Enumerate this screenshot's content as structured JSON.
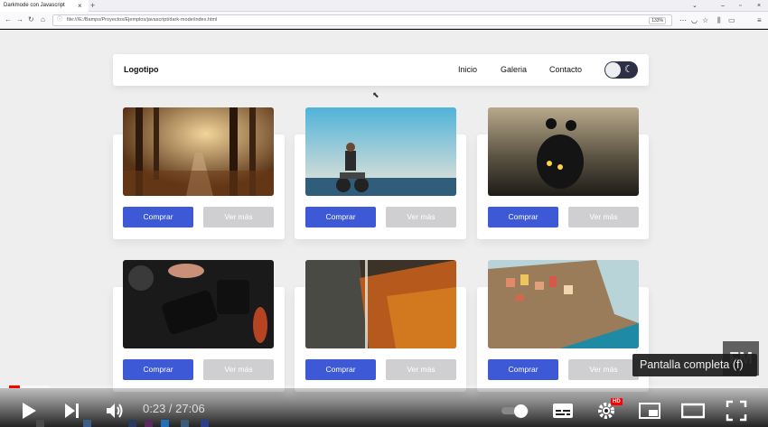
{
  "browser": {
    "tab_title": "Darkmode con Javascript",
    "tab_close": "×",
    "new_tab": "+",
    "url": "file:///E:/Bamps/Proyectos/Ejemplos/javascript/dark-mode/index.html",
    "zoom": "133%"
  },
  "site": {
    "logo": "Logotipo",
    "nav": [
      "Inicio",
      "Galeria",
      "Contacto"
    ],
    "buy_label": "Comprar",
    "more_label": "Ver más",
    "colors": {
      "accent": "#3d59d6",
      "secondary": "#cfcfd1",
      "toggle": "#2d3045"
    }
  },
  "cards": [
    {
      "photo": "forest-path"
    },
    {
      "photo": "man-on-motorbike-beach"
    },
    {
      "photo": "motorcycle-night-road"
    },
    {
      "photo": "camera-in-hand"
    },
    {
      "photo": "autumn-cliff"
    },
    {
      "photo": "coastal-village"
    }
  ],
  "player": {
    "fm_badge": "FM",
    "tooltip": "Pantalla completa (f)",
    "time": "0:23 / 27:06",
    "hd_badge": "HD",
    "progress_fraction": 0.0141
  }
}
